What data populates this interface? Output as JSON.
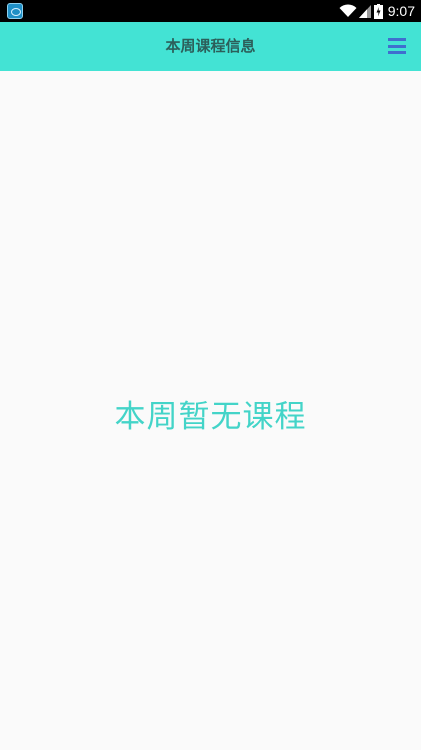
{
  "status_bar": {
    "time": "9:07",
    "notification_icon": "app-notification-icon",
    "wifi_icon": "wifi-icon",
    "signal_icon": "cell-signal-icon",
    "battery_icon": "battery-charging-icon"
  },
  "app_bar": {
    "title": "本周课程信息",
    "menu_icon": "hamburger-menu-icon",
    "background_color": "#43e3d4",
    "title_color": "#2c5f5a",
    "menu_color": "#3f6fcf"
  },
  "main": {
    "empty_message": "本周暂无课程",
    "empty_message_color": "#43d4c8",
    "background_color": "#fafafa"
  }
}
